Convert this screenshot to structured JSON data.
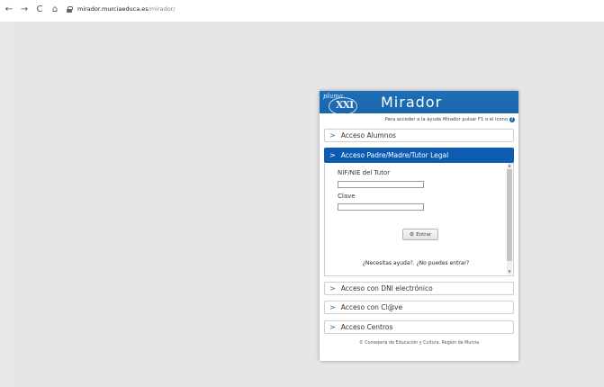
{
  "browser": {
    "url_host": "mirador.murciaeduca.es",
    "url_path": "/mirador/",
    "nav": {
      "back": "←",
      "forward": "→",
      "reload": "C",
      "home": "⌂"
    }
  },
  "panel": {
    "title": "Mirador",
    "logo_text": "pluma",
    "logo_mark": "XXI",
    "help_text": "Para acceder a la ayuda Mirador pulsar F1 o el icono",
    "help_icon": "?",
    "accordion": {
      "alumnos": "Acceso Alumnos",
      "padres": "Acceso Padre/Madre/Tutor Legal",
      "dni": "Acceso con DNI electrónico",
      "clave": "Acceso con Cl@ve",
      "centros": "Acceso Centros"
    },
    "form": {
      "nif_label": "NIF/NIE del Tutor",
      "nif_value": "",
      "clave_label": "Clave",
      "clave_value": "",
      "submit_label": "Entrar",
      "help_link": "¿Necesitas ayuda?",
      "separator": ". ",
      "cant_enter_link": "¿No puedes entrar?"
    },
    "footer": "© Consejería de Educación y Cultura. Región de Murcia"
  },
  "colors": {
    "accent": "#0e5cb1",
    "header": "#1d6fb8"
  }
}
